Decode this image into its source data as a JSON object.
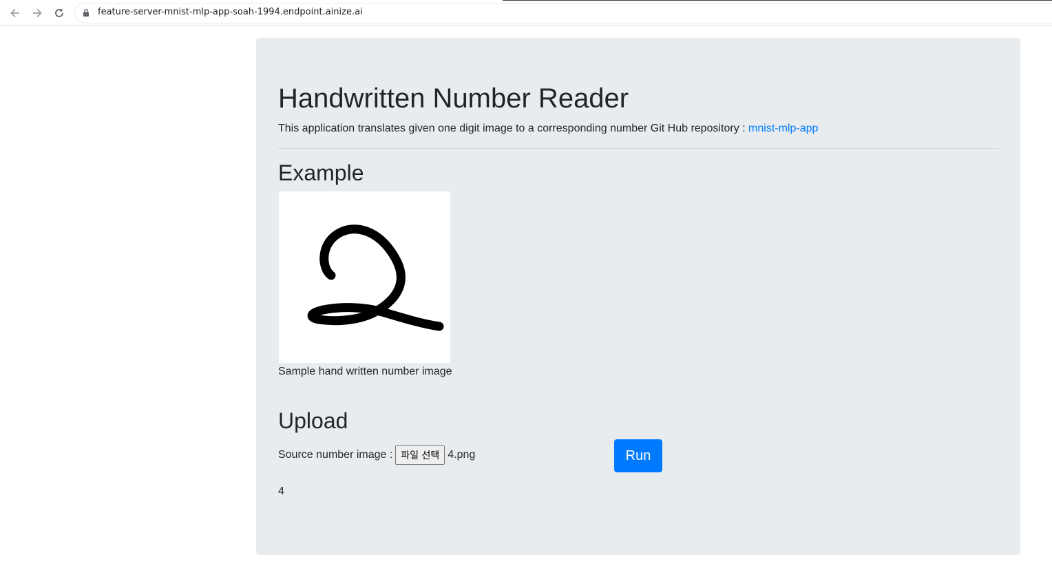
{
  "browser": {
    "url": "feature-server-mnist-mlp-app-soah-1994.endpoint.ainize.ai",
    "back_icon": "arrow-left-icon",
    "forward_icon": "arrow-right-icon",
    "reload_icon": "reload-icon",
    "lock_icon": "lock-icon"
  },
  "page": {
    "title": "Handwritten Number Reader",
    "lead_text": "This application translates given one digit image to a corresponding number Git Hub repository : ",
    "repo_link": "mnist-mlp-app",
    "example_heading": "Example",
    "example_caption": "Sample hand written number image",
    "upload_heading": "Upload",
    "source_label": "Source number image : ",
    "file_button_label": "파일 선택",
    "file_name": "4.png",
    "run_label": "Run",
    "result": "4"
  },
  "colors": {
    "jumbotron_bg": "#e9ecef",
    "link": "#007bff",
    "primary_button": "#007bff"
  }
}
